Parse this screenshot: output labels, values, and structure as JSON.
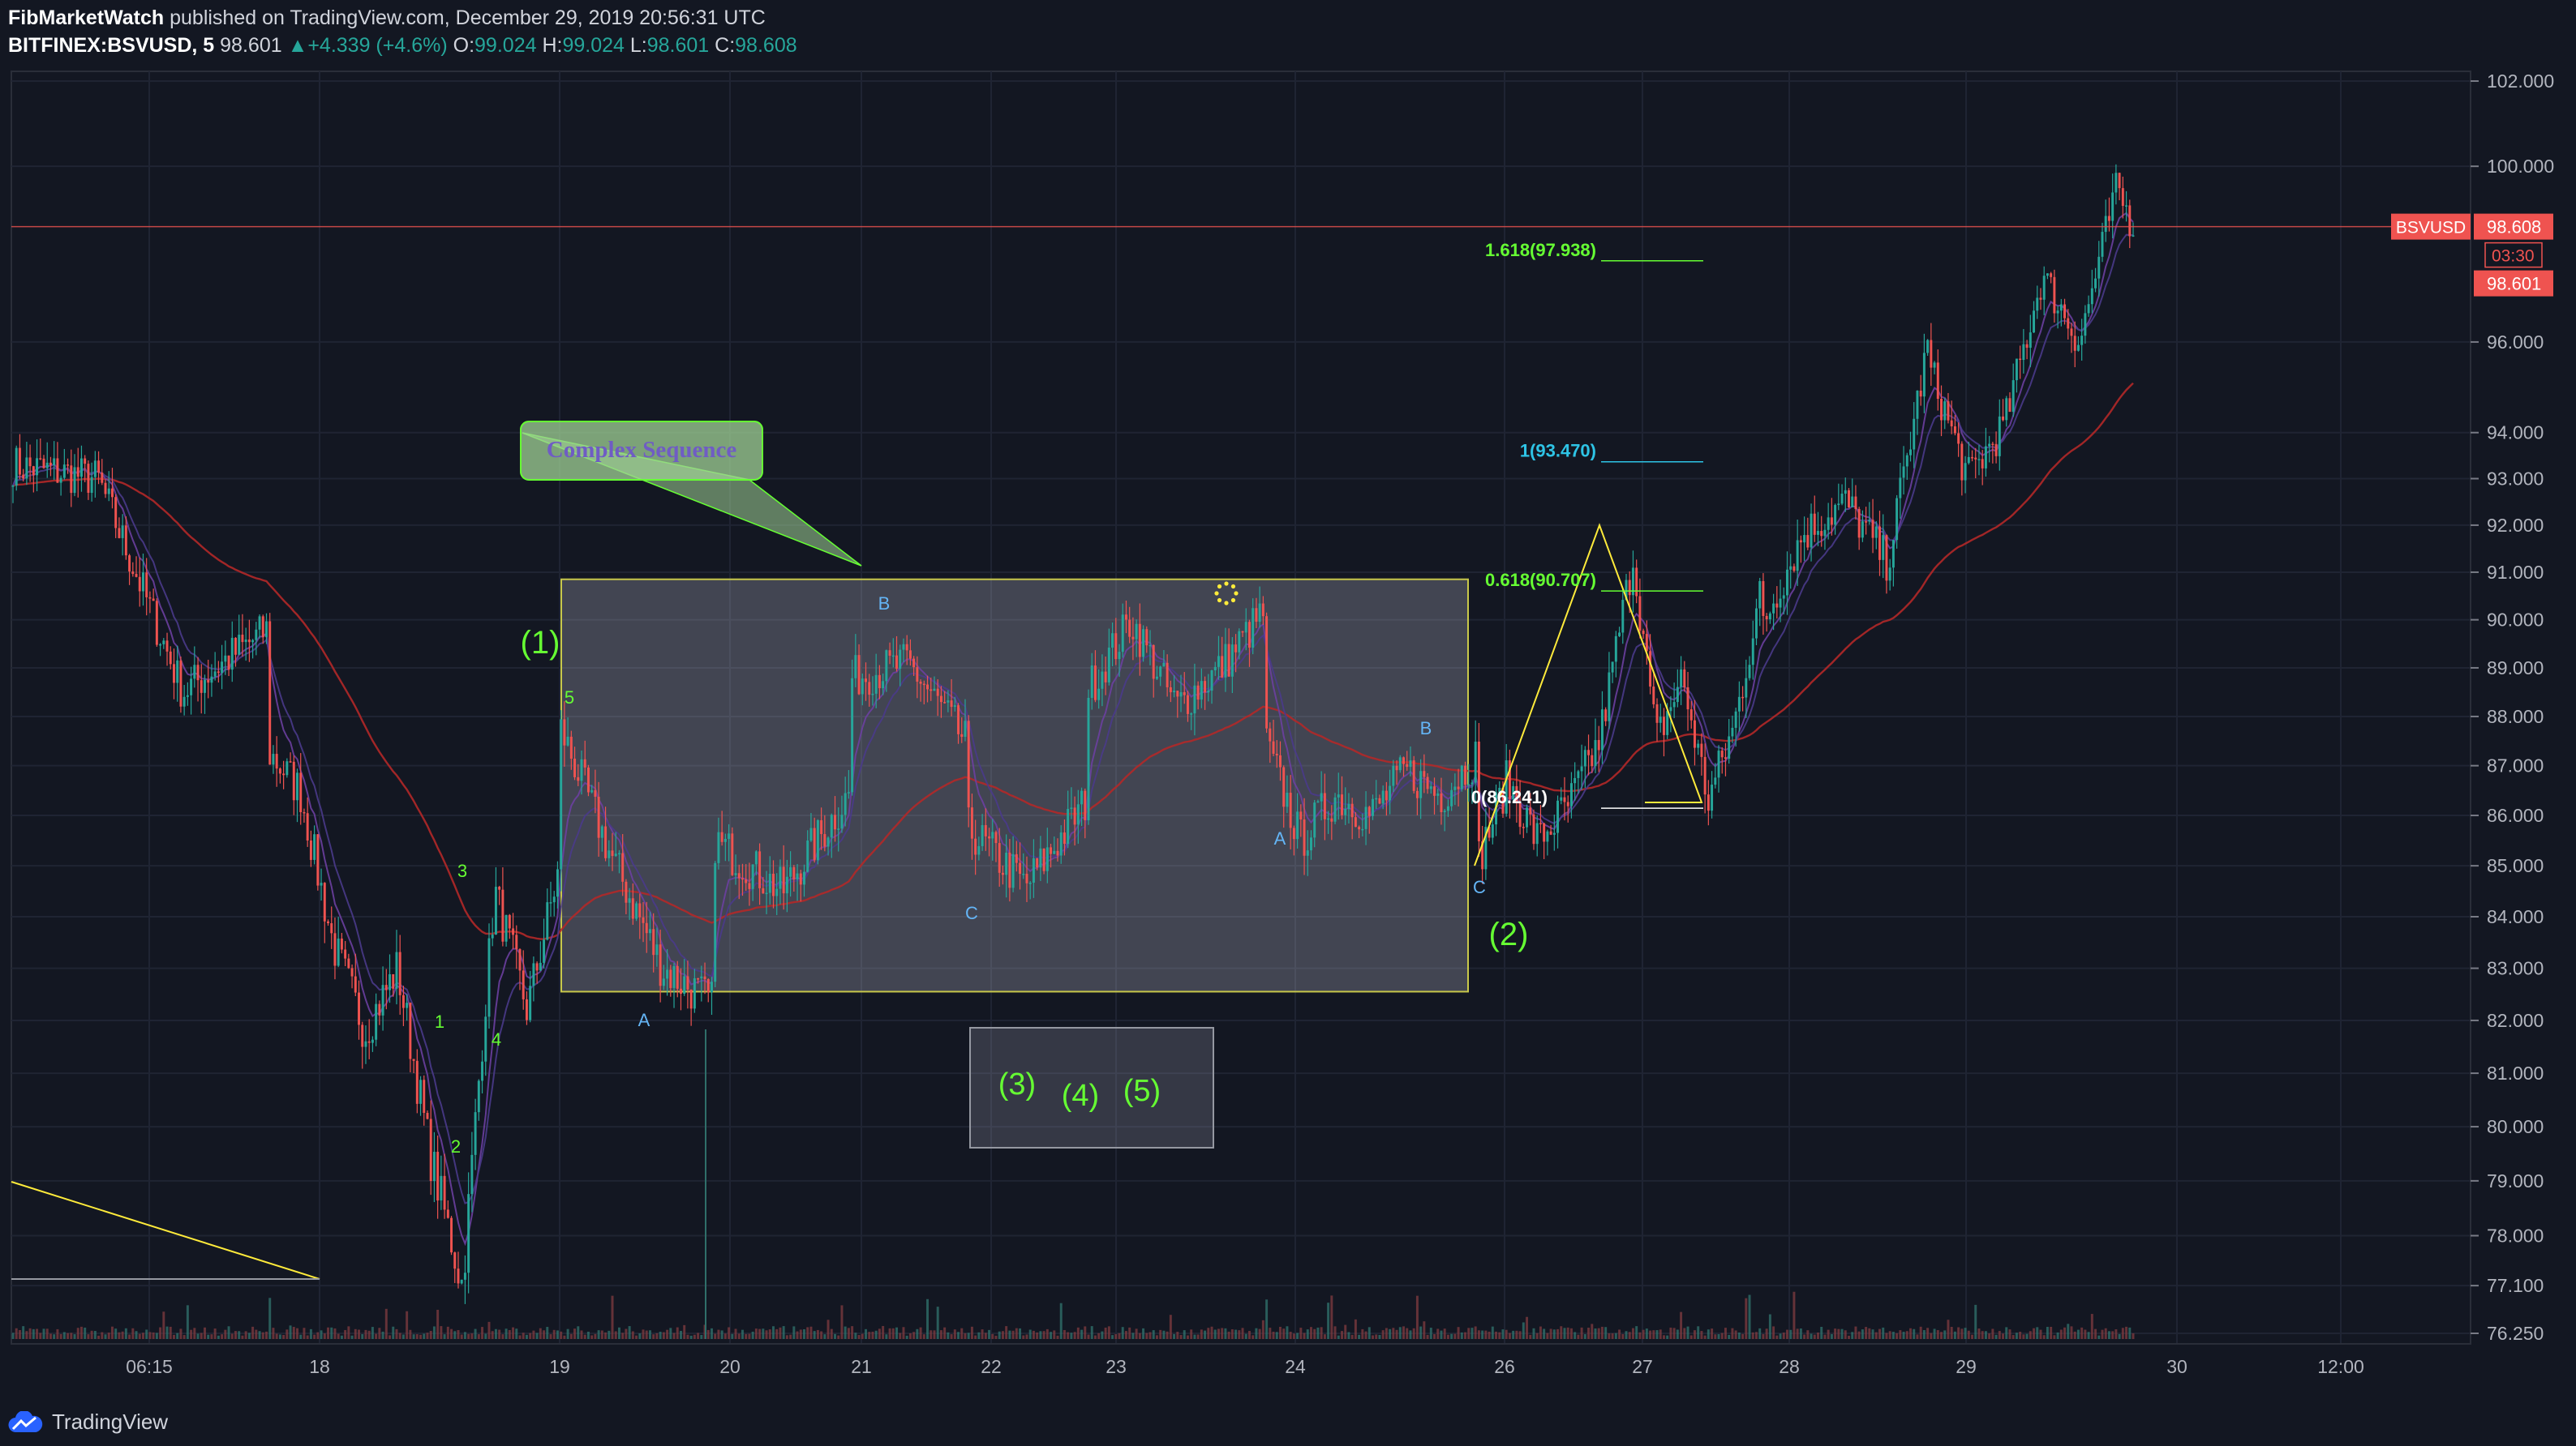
{
  "header": {
    "author": "FibMarketWatch",
    "published_text": "published on TradingView.com, December 29, 2019 20:56:31 UTC",
    "symbol": "BITFINEX:BSVUSD, 5",
    "last_price": "98.601",
    "change": "+4.339 (+4.6%)",
    "o_label": "O:",
    "o_value": "99.024",
    "h_label": "H:",
    "h_value": "99.024",
    "l_label": "L:",
    "l_value": "98.601",
    "c_label": "C:",
    "c_value": "98.608"
  },
  "footer": {
    "brand": "TradingView"
  },
  "price_badges": {
    "symbol": "BSVUSD",
    "last": "98.608",
    "countdown": "03:30",
    "low": "98.601"
  },
  "colors": {
    "background": "#131722",
    "grid": "#1f2433",
    "up": "#26a69a",
    "down": "#ef5350",
    "ema_slow": "#b22828",
    "ema_fast": "#6b3fa0",
    "annotation_green": "#66ff33",
    "wave_blue": "#64b5f6",
    "box_border": "#c8c84a",
    "fib_cyan": "#2ec4e6",
    "yellow": "#ffeb3b"
  },
  "chart_data": {
    "type": "candlestick",
    "symbol": "BITFINEX:BSVUSD",
    "interval": "5",
    "y_axis": {
      "scale": "log",
      "ylim": [
        76.25,
        102.0
      ],
      "ticks": [
        "102.000",
        "100.000",
        "96.000",
        "94.000",
        "93.000",
        "92.000",
        "91.000",
        "90.000",
        "89.000",
        "88.000",
        "87.000",
        "86.000",
        "85.000",
        "84.000",
        "83.000",
        "82.000",
        "81.000",
        "80.000",
        "79.000",
        "78.000",
        "77.100",
        "76.250"
      ]
    },
    "x_axis": {
      "ticks": [
        "06:15",
        "18",
        "19",
        "20",
        "21",
        "22",
        "23",
        "24",
        "26",
        "27",
        "28",
        "29",
        "30",
        "12:00"
      ]
    },
    "price_path": [
      [
        "06:15",
        93.3
      ],
      [
        "06:15",
        93.0
      ],
      [
        "06:15",
        88.5
      ],
      [
        "06:15",
        89.8
      ],
      [
        "18",
        87.3
      ],
      [
        "18",
        86.5
      ],
      [
        "18",
        83.5
      ],
      [
        "18",
        81.8
      ],
      [
        "18",
        83.0
      ],
      [
        "18",
        79.5
      ],
      [
        "18",
        77.1
      ],
      [
        "18",
        84.5
      ],
      [
        "18",
        82.2
      ],
      [
        "18",
        85.0
      ],
      [
        "19",
        87.8
      ],
      [
        "19",
        85.2
      ],
      [
        "19",
        83.0
      ],
      [
        "19",
        82.3
      ],
      [
        "20",
        85.5
      ],
      [
        "20",
        84.5
      ],
      [
        "20",
        86.5
      ],
      [
        "21",
        88.8
      ],
      [
        "21",
        89.1
      ],
      [
        "21",
        87.5
      ],
      [
        "22",
        85.8
      ],
      [
        "22",
        84.6
      ],
      [
        "22",
        86.3
      ],
      [
        "23",
        88.5
      ],
      [
        "23",
        90.0
      ],
      [
        "23",
        88.2
      ],
      [
        "23",
        89.0
      ],
      [
        "23",
        90.2
      ],
      [
        "24",
        87.5
      ],
      [
        "24",
        85.5
      ],
      [
        "24",
        86.4
      ],
      [
        "24",
        86.0
      ],
      [
        "24",
        86.9
      ],
      [
        "24",
        86.4
      ],
      [
        "24",
        87.2
      ],
      [
        "26",
        85.0
      ],
      [
        "26",
        86.7
      ],
      [
        "26",
        85.5
      ],
      [
        "26",
        86.2
      ],
      [
        "26",
        87.5
      ],
      [
        "26",
        91.0
      ],
      [
        "27",
        91.8
      ],
      [
        "27",
        87.5
      ],
      [
        "27",
        88.8
      ],
      [
        "27",
        86.3
      ],
      [
        "27",
        87.8
      ],
      [
        "27",
        90.5
      ],
      [
        "28",
        89.8
      ],
      [
        "28",
        91.8
      ],
      [
        "28",
        92.5
      ],
      [
        "28",
        91.2
      ],
      [
        "28",
        96.2
      ],
      [
        "29",
        95.4
      ],
      [
        "29",
        93.0
      ],
      [
        "29",
        94.2
      ],
      [
        "29",
        97.5
      ],
      [
        "29",
        96.0
      ],
      [
        "29",
        99.5
      ],
      [
        "30",
        98.6
      ]
    ],
    "annotations": {
      "callout": "Complex Sequence",
      "waves_major": [
        "(1)",
        "(2)",
        "(3)",
        "(4)",
        "(5)"
      ],
      "waves_minor": [
        "1",
        "2",
        "3",
        "4",
        "5"
      ],
      "abc_labels": [
        "A",
        "B",
        "C",
        "A",
        "B",
        "C"
      ],
      "fib_levels": [
        {
          "label": "1.618(97.938)",
          "value": 97.938
        },
        {
          "label": "1(93.470)",
          "value": 93.47
        },
        {
          "label": "0.618(90.707)",
          "value": 90.707
        },
        {
          "label": "0(86.241)",
          "value": 86.241
        }
      ]
    }
  }
}
